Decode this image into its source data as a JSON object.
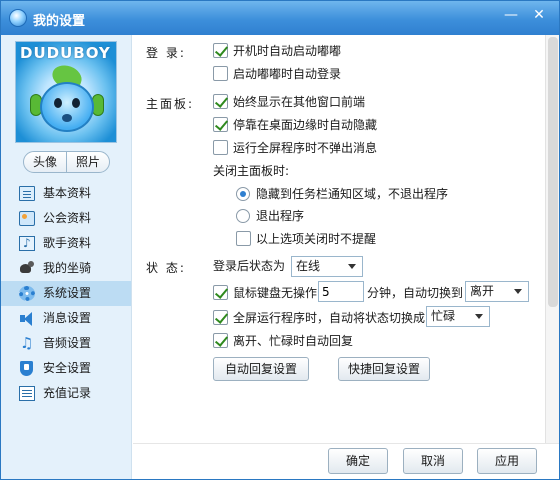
{
  "window": {
    "title": "我的设置",
    "minimize_glyph": "—",
    "close_glyph": "✕"
  },
  "sidebar": {
    "avatar_text": "DUDUBOY",
    "tabs": [
      "头像",
      "照片"
    ],
    "items": [
      {
        "label": "基本资料",
        "icon": "document-icon"
      },
      {
        "label": "公会资料",
        "icon": "guild-icon"
      },
      {
        "label": "歌手资料",
        "icon": "singer-icon"
      },
      {
        "label": "我的坐骑",
        "icon": "mount-icon"
      },
      {
        "label": "系统设置",
        "icon": "gear-icon",
        "active": true
      },
      {
        "label": "消息设置",
        "icon": "speaker-icon"
      },
      {
        "label": "音频设置",
        "icon": "music-icon"
      },
      {
        "label": "安全设置",
        "icon": "shield-icon"
      },
      {
        "label": "充值记录",
        "icon": "record-icon"
      }
    ]
  },
  "login": {
    "label": "登  录:",
    "options": [
      {
        "text": "开机时自动启动嘟嘟",
        "checked": true
      },
      {
        "text": "启动嘟嘟时自动登录",
        "checked": false
      }
    ]
  },
  "main_panel": {
    "label": "主面板:",
    "options": [
      {
        "text": "始终显示在其他窗口前端",
        "checked": true
      },
      {
        "text": "停靠在桌面边缘时自动隐藏",
        "checked": true
      },
      {
        "text": "运行全屏程序时不弹出消息",
        "checked": false
      }
    ],
    "close_label": "关闭主面板时:",
    "close_options": [
      {
        "text": "隐藏到任务栏通知区域，不退出程序",
        "selected": true
      },
      {
        "text": "退出程序",
        "selected": false
      }
    ],
    "no_remind": {
      "text": "以上选项关闭时不提醒",
      "checked": false
    }
  },
  "status": {
    "label": "状  态:",
    "login_status_label": "登录后状态为",
    "login_status_value": "在线",
    "idle_checkbox": {
      "text": "鼠标键盘无操作",
      "checked": true
    },
    "idle_minutes": "5",
    "idle_suffix": "分钟，自动切换到",
    "idle_status_value": "离开",
    "fullscreen_checkbox": {
      "text": "全屏运行程序时，自动将状态切换成",
      "checked": true
    },
    "fullscreen_status_value": "忙碌",
    "auto_reply_checkbox": {
      "text": "离开、忙碌时自动回复",
      "checked": true
    },
    "auto_reply_button": "自动回复设置",
    "quick_reply_button": "快捷回复设置"
  },
  "footer": {
    "ok": "确定",
    "cancel": "取消",
    "apply": "应用"
  }
}
